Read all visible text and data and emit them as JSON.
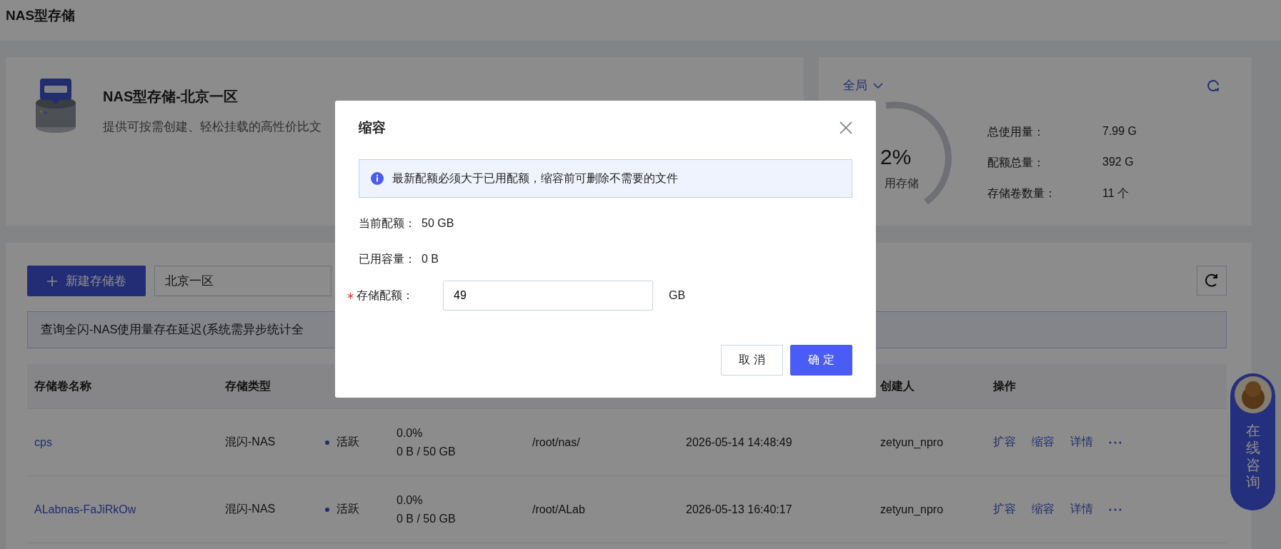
{
  "page_title": "NAS型存储",
  "product": {
    "title": "NAS型存储-北京一区",
    "description": "提供可按需创建、轻松挂载的高性价比文"
  },
  "summary": {
    "scope": "全局",
    "gauge": {
      "percent": "2%",
      "caption": "用存储"
    },
    "stats": [
      {
        "label": "总使用量：",
        "value": "7.99 G"
      },
      {
        "label": "配额总量：",
        "value": "392 G"
      },
      {
        "label": "存储卷数量：",
        "value": "11 个"
      }
    ]
  },
  "toolbar": {
    "create_button": "新建存储卷",
    "region": "北京一区"
  },
  "notice": "查询全闪-NAS使用量存在延迟(系统需异步统计全",
  "table": {
    "headers": {
      "name": "存储卷名称",
      "type": "存储类型",
      "creator": "创建人",
      "actions": "操作"
    },
    "rows": [
      {
        "name": "cps",
        "type": "混闪-NAS",
        "status": "活跃",
        "usage_percent": "0.0%",
        "usage": "0 B / 50 GB",
        "path": "/root/nas/",
        "created": "2026-05-14 14:48:49",
        "creator": "zetyun_npro",
        "actions": [
          "扩容",
          "缩容",
          "详情"
        ]
      },
      {
        "name": "ALabnas-FaJiRkOw",
        "type": "混闪-NAS",
        "status": "活跃",
        "usage_percent": "0.0%",
        "usage": "0 B / 50 GB",
        "path": "/root/ALab",
        "created": "2026-05-13 16:40:17",
        "creator": "zetyun_npro",
        "actions": [
          "扩容",
          "缩容",
          "详情"
        ]
      }
    ]
  },
  "chat_widget": {
    "label": "在线咨询"
  },
  "dialog": {
    "title": "缩容",
    "alert": "最新配额必须大于已用配额，缩容前可删除不需要的文件",
    "fields": [
      {
        "kind": "static",
        "label": "当前配额：",
        "value": "50 GB"
      },
      {
        "kind": "static",
        "label": "已用容量：",
        "value": "0 B"
      },
      {
        "kind": "input",
        "label": "存储配额：",
        "value": "49",
        "unit": "GB",
        "required": true
      }
    ],
    "buttons": [
      {
        "label": "取 消",
        "primary": false
      },
      {
        "label": "确 定",
        "primary": true
      }
    ]
  }
}
